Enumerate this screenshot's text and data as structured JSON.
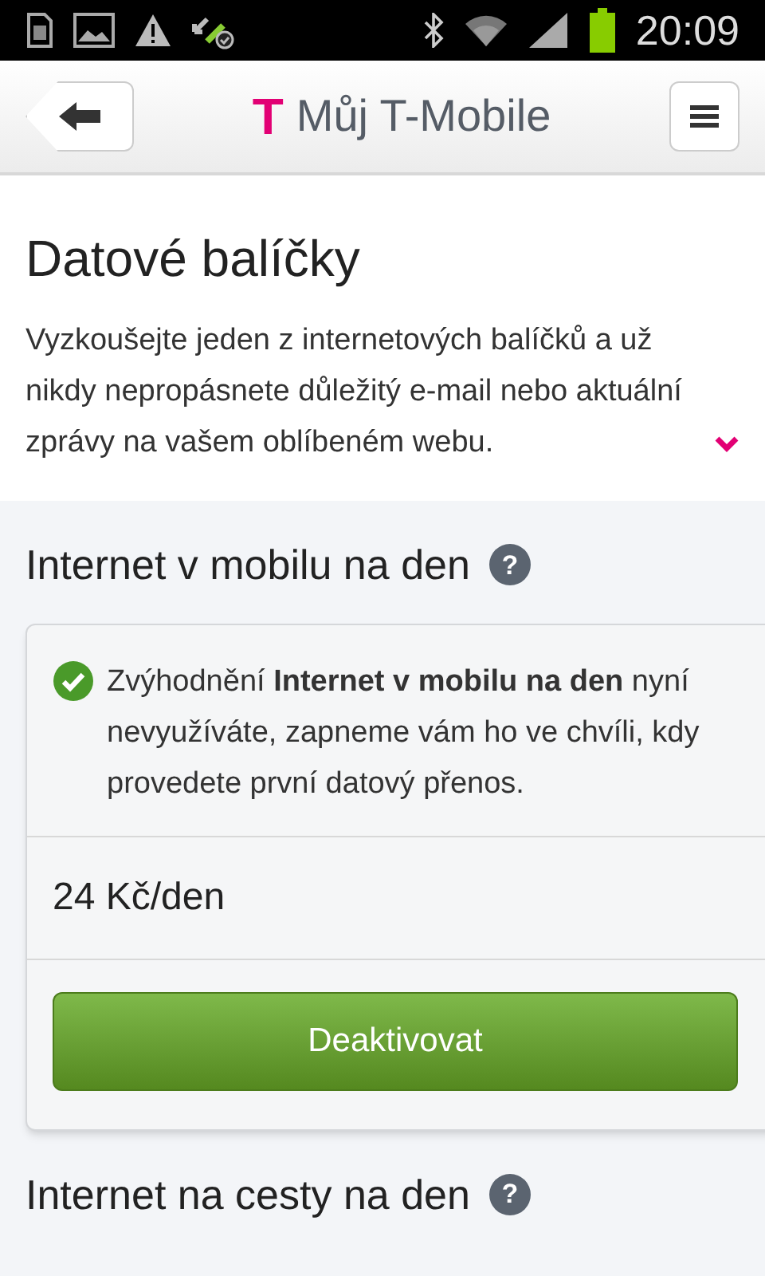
{
  "status_bar": {
    "time": "20:09"
  },
  "header": {
    "title": "Můj T-Mobile",
    "logo": "T"
  },
  "intro": {
    "title": "Datové balíčky",
    "text": "Vyzkoušejte jeden z internetových balíčků a už nikdy nepropásnete důležitý e-mail nebo aktuální zprávy na vašem oblíbeném webu.",
    "expanded": false
  },
  "packages": [
    {
      "title": "Internet v mobilu na den",
      "help": "?",
      "message": "Zvýhodnění **Internet v mobilu na den** nyní nevyužíváte, zapneme vám ho ve chvíli, kdy provedete první datový přenos.",
      "price": "24 Kč/den",
      "button": "Deaktivovat"
    },
    {
      "title": "Internet na cesty na den",
      "help": "?"
    }
  ]
}
